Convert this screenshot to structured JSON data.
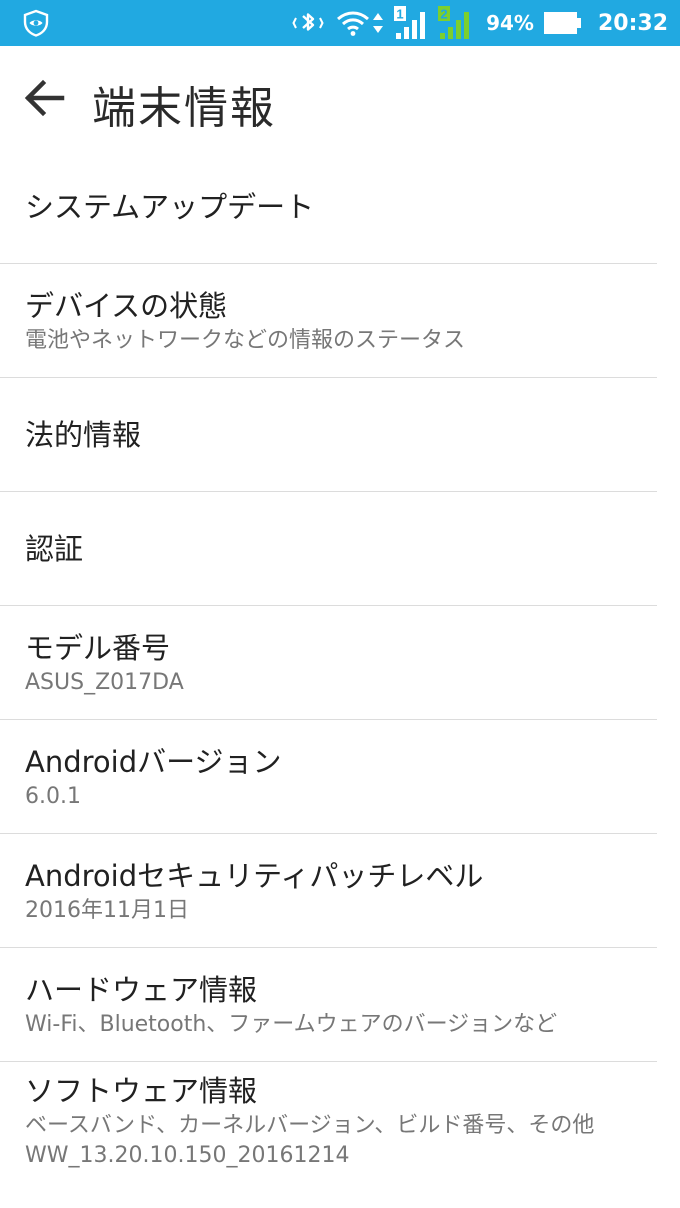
{
  "status_bar": {
    "battery_percent": "94%",
    "time": "20:32",
    "sim1_label": "1",
    "sim2_label": "2",
    "icons": [
      "shield-eye-icon",
      "bluetooth-icon",
      "wifi-icon",
      "data-arrows-icon",
      "sim1-signal-icon",
      "sim2-signal-icon",
      "battery-icon"
    ],
    "colors": {
      "background": "#21a9e1",
      "sim2_signal": "#7ccf2e"
    }
  },
  "header": {
    "title": "端末情報",
    "back_icon": "arrow-left-icon"
  },
  "items": [
    {
      "title": "システムアップデート"
    },
    {
      "title": "デバイスの状態",
      "summary": "電池やネットワークなどの情報のステータス"
    },
    {
      "title": "法的情報"
    },
    {
      "title": "認証"
    },
    {
      "title": "モデル番号",
      "summary": "ASUS_Z017DA"
    },
    {
      "title": "Androidバージョン",
      "summary": "6.0.1"
    },
    {
      "title": "Androidセキュリティパッチレベル",
      "summary": "2016年11月1日"
    },
    {
      "title": "ハードウェア情報",
      "summary": "Wi-Fi、Bluetooth、ファームウェアのバージョンなど"
    },
    {
      "title": "ソフトウェア情報",
      "summary": "ベースバンド、カーネルバージョン、ビルド番号、その他",
      "summary2": "WW_13.20.10.150_20161214"
    }
  ]
}
